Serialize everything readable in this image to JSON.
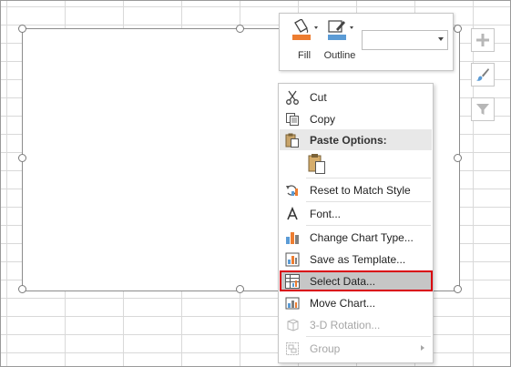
{
  "toolbar": {
    "fill_label": "Fill",
    "outline_label": "Outline",
    "fill_color": "#ed7d31",
    "outline_color": "#5b9bd5",
    "dropdown_value": ""
  },
  "side_buttons": [
    {
      "icon": "plus-icon"
    },
    {
      "icon": "paintbrush-icon"
    },
    {
      "icon": "filter-icon"
    }
  ],
  "menu": {
    "items": [
      {
        "label": "Cut",
        "icon": "scissors-icon"
      },
      {
        "label": "Copy",
        "icon": "copy-icon"
      },
      {
        "label": "Paste Options:",
        "icon": "paste-icon"
      },
      {
        "label": "Reset to Match Style",
        "icon": "reset-style-icon"
      },
      {
        "label": "Font...",
        "icon": "font-icon"
      },
      {
        "label": "Change Chart Type...",
        "icon": "chart-type-icon"
      },
      {
        "label": "Save as Template...",
        "icon": "save-template-icon"
      },
      {
        "label": "Select Data...",
        "icon": "select-data-icon"
      },
      {
        "label": "Move Chart...",
        "icon": "move-chart-icon"
      },
      {
        "label": "3-D Rotation...",
        "icon": "rotation-3d-icon"
      },
      {
        "label": "Group",
        "icon": "group-icon"
      }
    ]
  },
  "colors": {
    "highlight_border": "#d9000f",
    "selected_background": "#c6c6c6"
  }
}
